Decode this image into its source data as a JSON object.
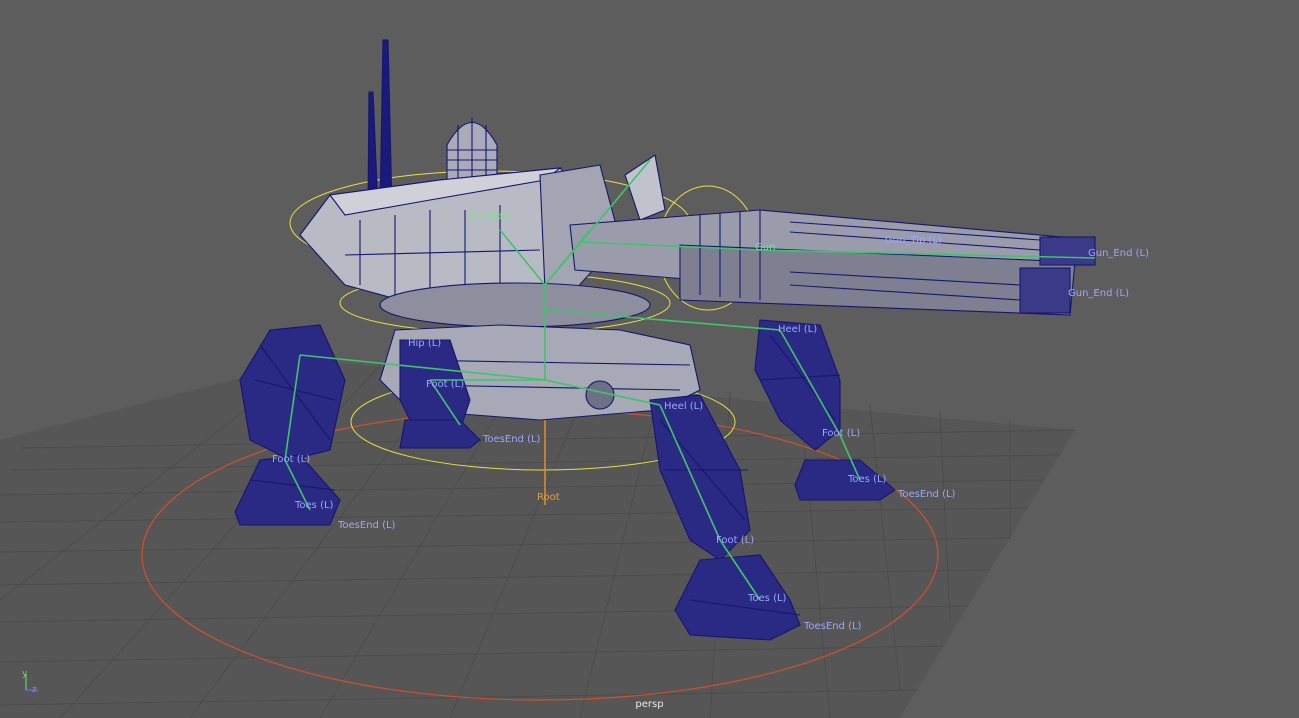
{
  "viewport": {
    "camera_name": "persp",
    "background_color": "#5d5d5d",
    "grid_color": "#4a4a4a",
    "mesh_color": "#16166e",
    "joint_color": "#3aa860",
    "label_color": "#9aa7ff"
  },
  "axis_gizmo": {
    "y_label": "y",
    "z_label": "z"
  },
  "joint_labels": {
    "root": "Root",
    "gun_tip": "Gun_Tip (L)",
    "gun_end_upper": "Gun_End (L)",
    "gun_end_lower": "Gun_End (L)",
    "gun": "Gun",
    "heel_back_right": "Heel (L)",
    "heel_front": "Heel (L)",
    "hip": "Hip (L)",
    "foot_back": "Foot (L)",
    "foot_left": "Foot (L)",
    "foot_right": "Foot (L)",
    "foot_front": "Foot (L)",
    "toesend_back": "ToesEnd (L)",
    "toesend_left": "ToesEnd (L)",
    "toesend_right": "ToesEnd (L)",
    "toesend_front": "ToesEnd (L)",
    "toes_left": "Toes (L)",
    "toes_right": "Toes (L)",
    "toes_front": "Toes (L)",
    "spine_top": "Spine",
    "shoulder": "Shoulder"
  }
}
